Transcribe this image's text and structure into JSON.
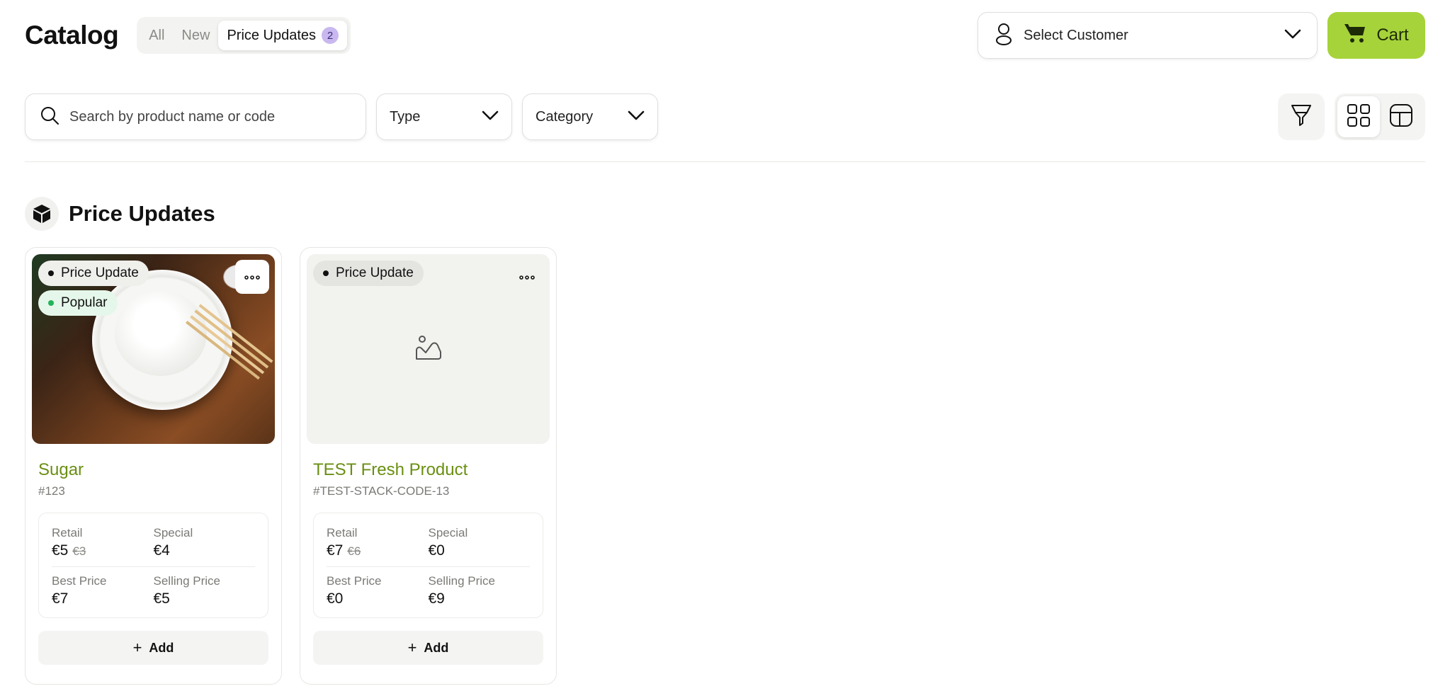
{
  "header": {
    "title": "Catalog",
    "tabs": [
      {
        "label": "All"
      },
      {
        "label": "New"
      },
      {
        "label": "Price Updates",
        "count": "2"
      }
    ],
    "customer_select": "Select Customer",
    "cart_label": "Cart"
  },
  "filters": {
    "search_placeholder": "Search by product name or code",
    "type_label": "Type",
    "category_label": "Category"
  },
  "section": {
    "title": "Price Updates"
  },
  "products": [
    {
      "name": "Sugar",
      "code": "#123",
      "badges": [
        "Price Update",
        "Popular"
      ],
      "prices": {
        "retail_label": "Retail",
        "retail": "€5",
        "retail_old": "€3",
        "special_label": "Special",
        "special": "€4",
        "best_label": "Best Price",
        "best": "€7",
        "selling_label": "Selling Price",
        "selling": "€5"
      },
      "add_label": "Add"
    },
    {
      "name": "TEST Fresh Product",
      "code": "#TEST-STACK-CODE-13",
      "badges": [
        "Price Update"
      ],
      "prices": {
        "retail_label": "Retail",
        "retail": "€7",
        "retail_old": "€6",
        "special_label": "Special",
        "special": "€0",
        "best_label": "Best Price",
        "best": "€0",
        "selling_label": "Selling Price",
        "selling": "€9"
      },
      "add_label": "Add"
    }
  ],
  "colors": {
    "accent": "#a6d33a",
    "product_name": "#6a8f12",
    "tab_badge": "#c9b8ef",
    "popular_dot": "#22b35b"
  },
  "icons": {
    "customer": "user-icon",
    "cart": "cart-icon",
    "search": "search-icon",
    "filter": "filter-icon",
    "grid_view": "grid-view-icon",
    "layout_view": "layout-view-icon",
    "section": "box-icon",
    "placeholder": "image-placeholder-icon",
    "more": "more-dots-icon"
  }
}
